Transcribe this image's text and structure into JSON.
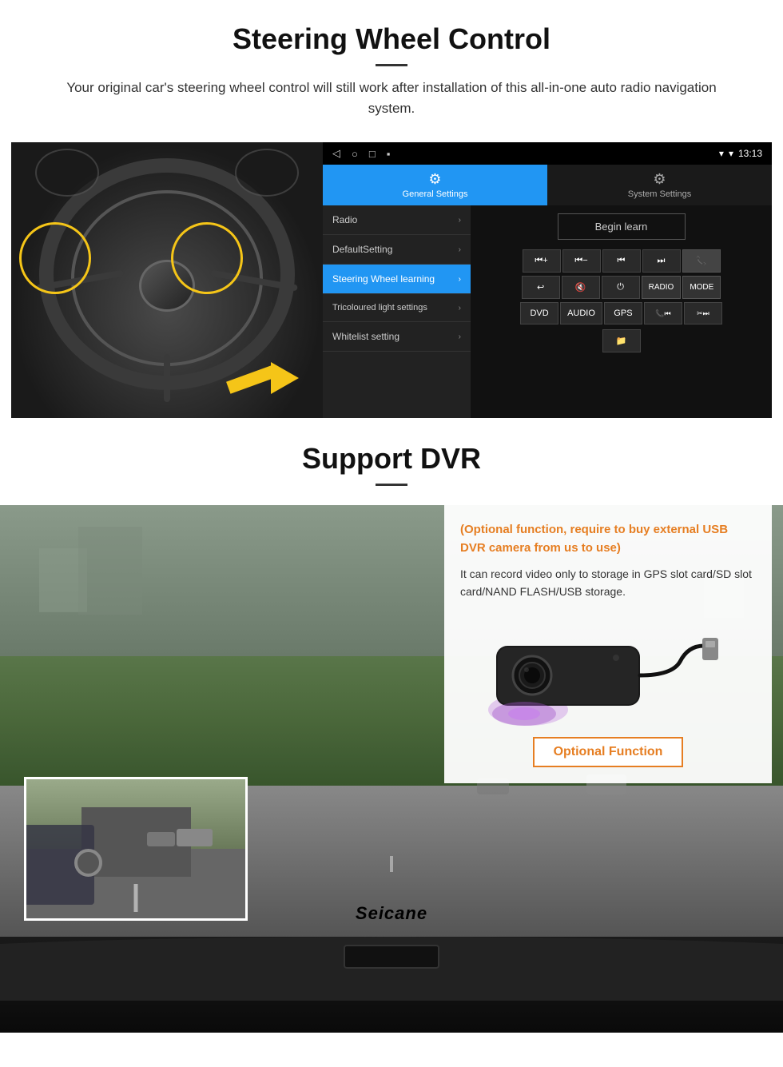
{
  "steering_section": {
    "title": "Steering Wheel Control",
    "description": "Your original car's steering wheel control will still work after installation of this all-in-one auto radio navigation system.",
    "android_ui": {
      "statusbar": {
        "signal_icon": "▾",
        "wifi_icon": "▾",
        "time": "13:13"
      },
      "tabs": [
        {
          "label": "General Settings",
          "active": true,
          "icon": "⚙"
        },
        {
          "label": "System Settings",
          "active": false,
          "icon": "🔧"
        }
      ],
      "menu_items": [
        {
          "label": "Radio",
          "active": false
        },
        {
          "label": "DefaultSetting",
          "active": false
        },
        {
          "label": "Steering Wheel learning",
          "active": true
        },
        {
          "label": "Tricoloured light settings",
          "active": false
        },
        {
          "label": "Whitelist setting",
          "active": false
        }
      ],
      "begin_learn_label": "Begin learn",
      "control_buttons_row1": [
        "⏮+",
        "⏮−",
        "⏮",
        "⏭",
        "📞"
      ],
      "control_buttons_row2": [
        "↩",
        "🔇",
        "⏻",
        "RADIO",
        "MODE"
      ],
      "control_buttons_row3": [
        "DVD",
        "AUDIO",
        "GPS",
        "📞⏮",
        "✂⏭"
      ]
    }
  },
  "dvr_section": {
    "title": "Support DVR",
    "info_title": "(Optional function, require to buy external USB DVR camera from us to use)",
    "info_text": "It can record video only to storage in GPS slot card/SD slot card/NAND FLASH/USB storage.",
    "optional_button_label": "Optional Function",
    "brand": "Seicane"
  }
}
